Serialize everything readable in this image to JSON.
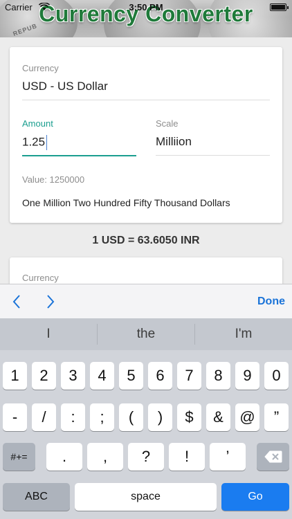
{
  "status": {
    "carrier": "Carrier",
    "time": "3:50 PM"
  },
  "header": {
    "title": "Currency Converter",
    "coin_text": "REPUB"
  },
  "from_card": {
    "currency_label": "Currency",
    "currency_value": "USD - US Dollar",
    "amount_label": "Amount",
    "amount_value": "1.25",
    "scale_label": "Scale",
    "scale_value": "Milliion",
    "value_text": "Value: 1250000",
    "words_text": "One Million Two Hundred Fifty Thousand Dollars"
  },
  "rate_text": "1 USD = 63.6050 INR",
  "to_card": {
    "currency_label": "Currency"
  },
  "accessory": {
    "done_label": "Done",
    "prev_icon": "chevron-left-icon",
    "next_icon": "chevron-right-icon"
  },
  "predictions": [
    "I",
    "the",
    "I'm"
  ],
  "keyboard": {
    "row1": [
      "1",
      "2",
      "3",
      "4",
      "5",
      "6",
      "7",
      "8",
      "9",
      "0"
    ],
    "row2": [
      "-",
      "/",
      ":",
      ";",
      "(",
      ")",
      "$",
      "&",
      "@",
      "”"
    ],
    "row3_left": "#+=",
    "row3": [
      ".",
      ",",
      "?",
      "!",
      "’"
    ],
    "backspace_icon": "backspace-icon",
    "abc_label": "ABC",
    "space_label": "space",
    "go_label": "Go"
  },
  "colors": {
    "accent": "#1a9e8f",
    "title_green": "#1f7a3a",
    "ios_blue": "#1a73d8",
    "go_blue": "#1a7cf0"
  }
}
